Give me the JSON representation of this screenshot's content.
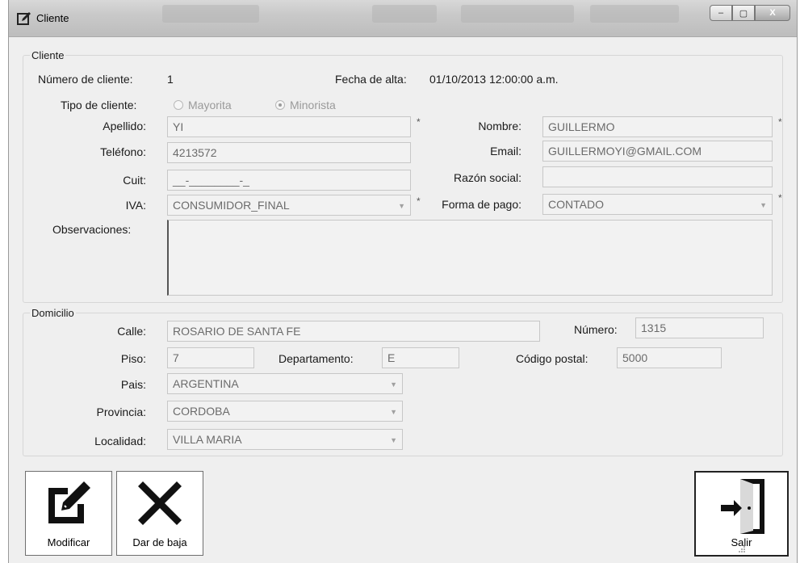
{
  "window": {
    "title": "Cliente",
    "controls": [
      "–",
      "▢",
      "X"
    ]
  },
  "cliente_group": {
    "label": "Cliente",
    "numero_label": "Número de cliente:",
    "numero_value": "1",
    "fecha_label": "Fecha de alta:",
    "fecha_value": "01/10/2013 12:00:00 a.m.",
    "tipo_label": "Tipo de cliente:",
    "tipo_options": [
      {
        "label": "Mayorita",
        "selected": false
      },
      {
        "label": "Minorista",
        "selected": true
      }
    ],
    "apellido_label": "Apellido:",
    "apellido_value": "YI",
    "nombre_label": "Nombre:",
    "nombre_value": "GUILLERMO",
    "telefono_label": "Teléfono:",
    "telefono_value": "4213572",
    "email_label": "Email:",
    "email_value": "GUILLERMOYI@GMAIL.COM",
    "cuit_label": "Cuit:",
    "cuit_value": "__-________-_",
    "razon_label": "Razón social:",
    "razon_value": "",
    "iva_label": "IVA:",
    "iva_value": "CONSUMIDOR_FINAL",
    "forma_pago_label": "Forma de pago:",
    "forma_pago_value": "CONTADO",
    "observaciones_label": "Observaciones:",
    "observaciones_value": "",
    "required_mark": "*"
  },
  "domicilio_group": {
    "label": "Domicilio",
    "calle_label": "Calle:",
    "calle_value": "ROSARIO DE SANTA FE",
    "numero_label": "Número:",
    "numero_value": "1315",
    "piso_label": "Piso:",
    "piso_value": "7",
    "departamento_label": "Departamento:",
    "departamento_value": "E",
    "codigo_postal_label": "Código postal:",
    "codigo_postal_value": "5000",
    "pais_label": "Pais:",
    "pais_value": "ARGENTINA",
    "provincia_label": "Provincia:",
    "provincia_value": "CORDOBA",
    "localidad_label": "Localidad:",
    "localidad_value": "VILLA MARIA"
  },
  "buttons": {
    "modificar": "Modificar",
    "dar_de_baja": "Dar de baja",
    "salir": "Salir"
  },
  "icons": {
    "window_icon": "edit-window-icon",
    "modificar_icon": "edit-icon",
    "dar_de_baja_icon": "delete-x-icon",
    "salir_icon": "exit-door-icon"
  }
}
